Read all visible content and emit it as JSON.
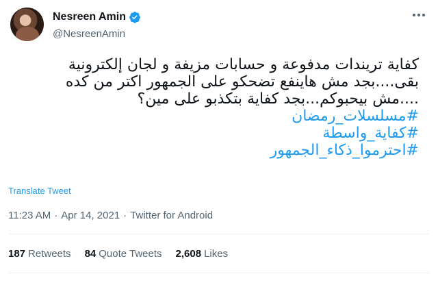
{
  "author": {
    "display_name": "Nesreen Amin",
    "handle": "@NesreenAmin",
    "verified_icon": "verified-badge-icon",
    "verified_color": "#1d9bf0"
  },
  "tweet": {
    "lines": [
      "كفاية تريندات مدفوعة و حسابات مزيفة و لجان إلكترونية",
      "بقى....بجد مش هاينفع تضحكو على الجمهور اكتر من كده",
      "....مش بيحبوكم...بجد كفاية بتكذبو على مين؟"
    ],
    "hashtags": [
      "#مسلسلات_رمضان",
      "#كفاية_واسطة",
      "#احترموا_ذكاء_الجمهور"
    ]
  },
  "translate_label": "Translate Tweet",
  "meta": {
    "time": "11:23 AM",
    "separator": "·",
    "date": "Apr 14, 2021",
    "source": "Twitter for Android"
  },
  "stats": {
    "retweets_count": "187",
    "retweets_label": "Retweets",
    "quotes_count": "84",
    "quotes_label": "Quote Tweets",
    "likes_count": "2,608",
    "likes_label": "Likes"
  },
  "colors": {
    "link": "#1d9bf0",
    "secondary_text": "#536471",
    "primary_text": "#0f1419"
  }
}
